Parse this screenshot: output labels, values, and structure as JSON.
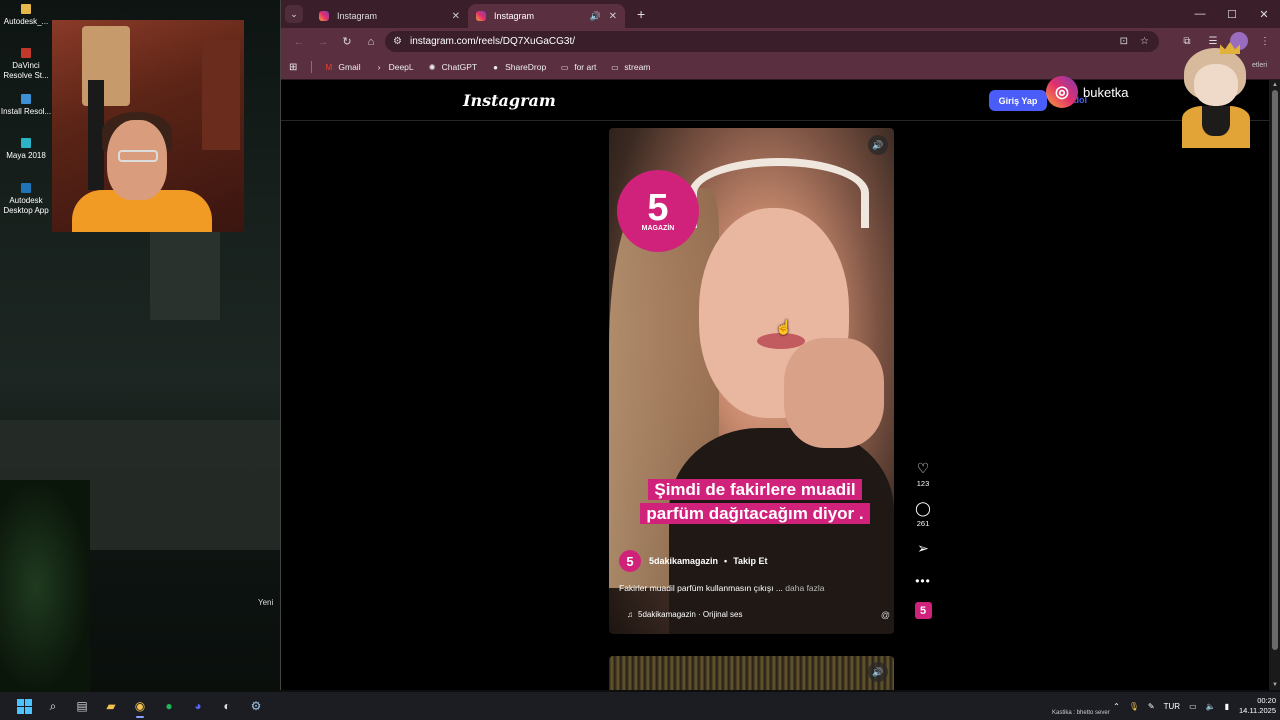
{
  "desktop": {
    "icons": [
      {
        "label": "Autodesk_...",
        "color": "#e6b84a"
      },
      {
        "label": "DaVinci Resolve St...",
        "color": "#c0392b"
      },
      {
        "label": "Install Resol...",
        "color": "#3d8fd6"
      },
      {
        "label": "Maya 2018",
        "color": "#2bb3c6"
      },
      {
        "label": "Autodesk Desktop App",
        "color": "#1f73b7"
      }
    ],
    "partial_label": "Yeni"
  },
  "browser": {
    "tabs": [
      {
        "title": "Instagram",
        "active": false
      },
      {
        "title": "Instagram",
        "active": true
      }
    ],
    "url": "instagram.com/reels/DQ7XuGaCG3t/",
    "bookmarks": [
      {
        "label": "Gmail",
        "icon": "gmail-icon"
      },
      {
        "label": "DeepL",
        "icon": "deepl-icon"
      },
      {
        "label": "ChatGPT",
        "icon": "chatgpt-icon"
      },
      {
        "label": "ShareDrop",
        "icon": "sharedrop-icon"
      },
      {
        "label": "for art",
        "icon": "folder-icon"
      },
      {
        "label": "stream",
        "icon": "folder-icon"
      }
    ],
    "partial_right_text": "etleri"
  },
  "instagram": {
    "logo": "Instagram",
    "login_label": "Giriş Yap",
    "signup_label": "Kaydol",
    "reel": {
      "badge_number": "5",
      "badge_text": "MAGAZİN",
      "caption_overlay": "Şimdi de fakirlere muadil parfüm dağıtacağım diyor .",
      "author": "5dakikamagazin",
      "follow_label": "Takip Et",
      "description": "Fakirler muadil parfüm kullanmasın çıkışı ...",
      "more_label": "daha fazla",
      "audio": "5dakikamagazin · Orijinal ses"
    },
    "actions": {
      "likes": "123",
      "comments": "261"
    }
  },
  "overlay": {
    "handle": "buketka"
  },
  "taskbar": {
    "language": "TUR",
    "time": "00:20",
    "date": "14.11.2025",
    "now_playing": "Kastika : bhetto sever",
    "discord_badge_color": "#f23f43"
  }
}
